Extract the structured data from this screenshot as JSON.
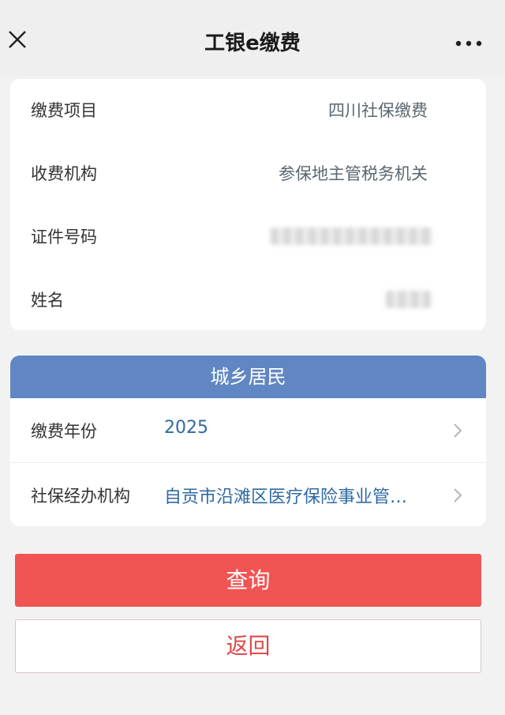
{
  "nav": {
    "title": "工银e缴费",
    "close_icon": "close-icon",
    "more_icon": "more-icon"
  },
  "info": {
    "rows": [
      {
        "label": "缴费项目",
        "value": "四川社保缴费"
      },
      {
        "label": "收费机构",
        "value": "参保地主管税务机关"
      },
      {
        "label": "证件号码",
        "value": ""
      },
      {
        "label": "姓名",
        "value": ""
      }
    ]
  },
  "form": {
    "header": "城乡居民",
    "year_label": "缴费年份",
    "year_value": "2025",
    "agency_label": "社保经办机构",
    "agency_value": "自贡市沿滩区医疗保险事业管…"
  },
  "buttons": {
    "query": "查询",
    "back": "返回"
  },
  "colors": {
    "header_blue": "#6086c3",
    "value_blue": "#2f6aa3",
    "primary_red": "#f15453",
    "back_text_red": "#e0484a"
  }
}
